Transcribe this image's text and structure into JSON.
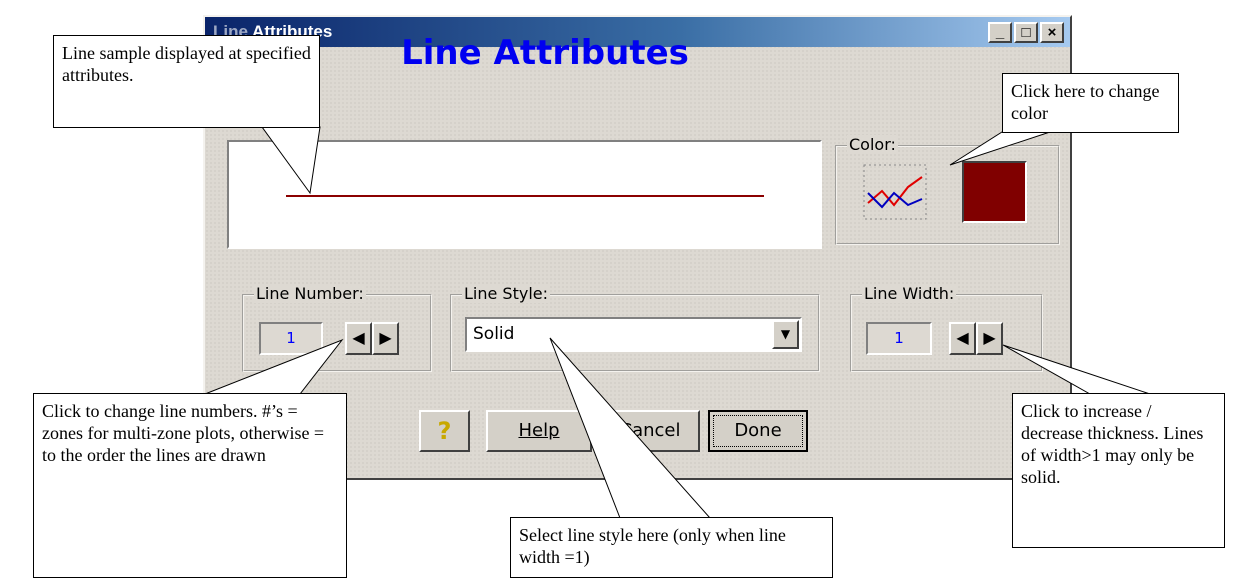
{
  "window": {
    "title": "Attributes",
    "title_prefix_obscured": "Line",
    "controls": {
      "minimize": "_",
      "maximize": "□",
      "close": "×"
    }
  },
  "dialog": {
    "heading": "Line Attributes",
    "preview_line_color": "#8b0000",
    "color_group": {
      "label": "Color:",
      "swatch_color": "#800000",
      "icon": "line-chart-icon"
    },
    "line_number": {
      "label": "Line Number:",
      "value": "1"
    },
    "line_style": {
      "label": "Line Style:",
      "value": "Solid"
    },
    "line_width": {
      "label": "Line Width:",
      "value": "1"
    },
    "buttons": {
      "help_icon": "question-mark-icon",
      "help": "Help",
      "cancel": "Cancel",
      "done": "Done"
    }
  },
  "callouts": {
    "sample": "Line sample displayed at specified attributes.",
    "color": "Click here to change color",
    "line_number": "Click to change line numbers.  #’s = zones for multi-zone plots, otherwise = to the order the lines are drawn",
    "line_style": "Select line style here (only when line width =1)",
    "line_width": "Click to increase / decrease thickness. Lines of width>1 may only be solid."
  }
}
